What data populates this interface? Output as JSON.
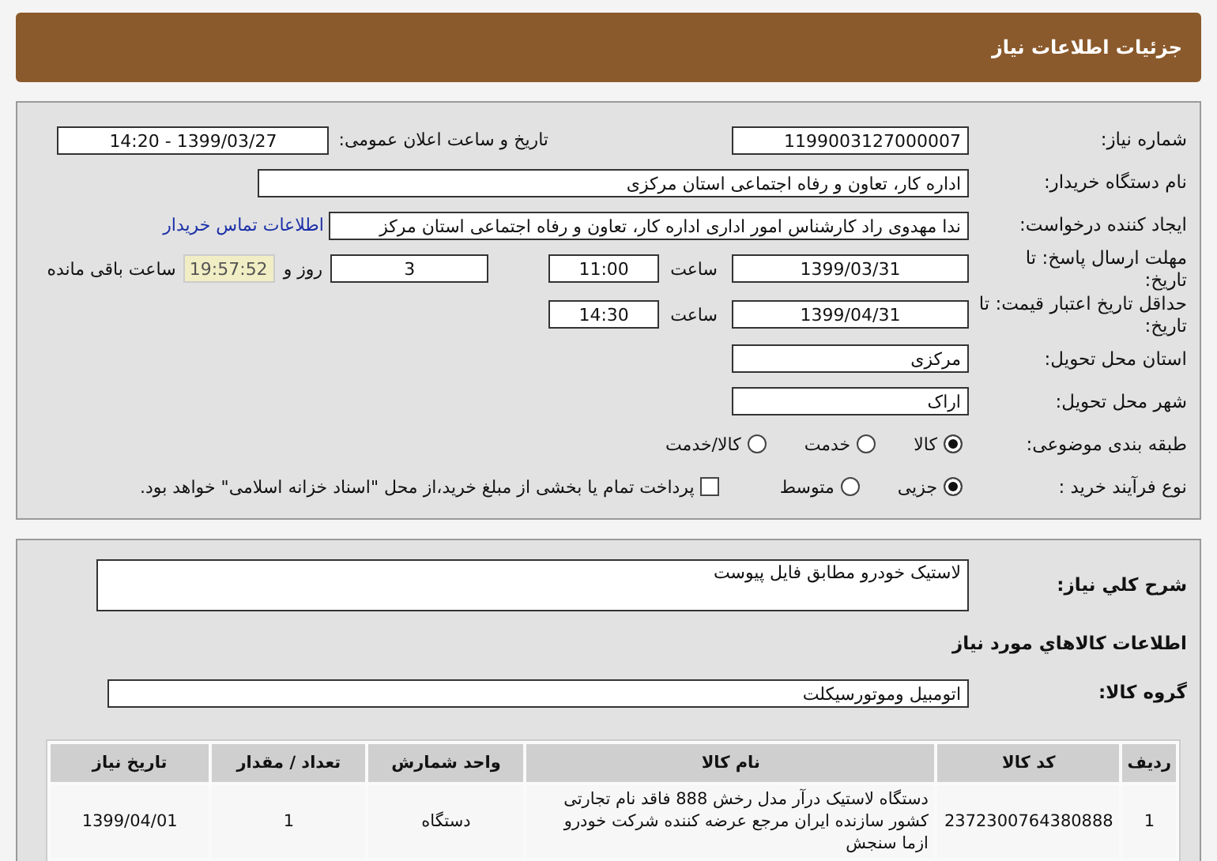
{
  "header": {
    "title": "جزئیات اطلاعات نیاز"
  },
  "details": {
    "need_number": {
      "label": "شماره نیاز:",
      "value": "1199003127000007"
    },
    "announcement": {
      "label": "تاریخ و ساعت اعلان عمومی:",
      "value": "1399/03/27 - 14:20"
    },
    "buyer": {
      "label": "نام دستگاه خریدار:",
      "value": "اداره کار، تعاون و رفاه اجتماعی استان مرکزی"
    },
    "requester": {
      "label": "ایجاد کننده درخواست:",
      "value": "ندا مهدوی راد کارشناس امور اداری اداره کار، تعاون و رفاه اجتماعی استان مرکز",
      "link": "اطلاعات تماس خریدار"
    },
    "reply_deadline": {
      "label": "مهلت ارسال پاسخ: تا تاریخ:",
      "date": "1399/03/31",
      "time_label": "ساعت",
      "time": "11:00",
      "days": "3",
      "days_label": "روز و",
      "remaining": "19:57:52",
      "remaining_label": "ساعت باقی مانده"
    },
    "price_validity": {
      "label": "حداقل تاریخ اعتبار قیمت: تا تاریخ:",
      "date": "1399/04/31",
      "time_label": "ساعت",
      "time": "14:30"
    },
    "province": {
      "label": "استان محل تحویل:",
      "value": "مرکزی"
    },
    "city": {
      "label": "شهر محل تحویل:",
      "value": "اراک"
    },
    "category": {
      "label": "طبقه بندی موضوعی:",
      "options": [
        {
          "label": "کالا",
          "selected": true
        },
        {
          "label": "خدمت",
          "selected": false
        },
        {
          "label": "کالا/خدمت",
          "selected": false
        }
      ]
    },
    "purchase_type": {
      "label": "نوع فرآیند خرید :",
      "options": [
        {
          "label": "جزیی",
          "selected": true
        },
        {
          "label": "متوسط",
          "selected": false
        }
      ],
      "treasury": {
        "label": "پرداخت تمام یا بخشی از مبلغ خرید،از محل \"اسناد خزانه اسلامی\" خواهد بود.",
        "checked": false
      }
    }
  },
  "need": {
    "description": {
      "label": "شرح کلي نياز:",
      "value": "لاستیک خودرو مطابق فایل پیوست"
    },
    "goods_heading": "اطلاعات کالاهاي مورد نياز",
    "goods_group": {
      "label": "گروه کالا:",
      "value": "اتومبیل وموتورسیکلت"
    },
    "table": {
      "columns": [
        "ردیف",
        "کد کالا",
        "نام کالا",
        "واحد شمارش",
        "تعداد / مقدار",
        "تاریخ نیاز"
      ],
      "rows": [
        {
          "cells": [
            "1",
            "2372300764380888",
            "دستگاه لاستیک درآر مدل رخش 888 فاقد نام تجارتی کشور سازنده ایران مرجع عرضه کننده شرکت خودرو ازما سنجش",
            "دستگاه",
            "1",
            "1399/04/01"
          ]
        }
      ]
    }
  }
}
